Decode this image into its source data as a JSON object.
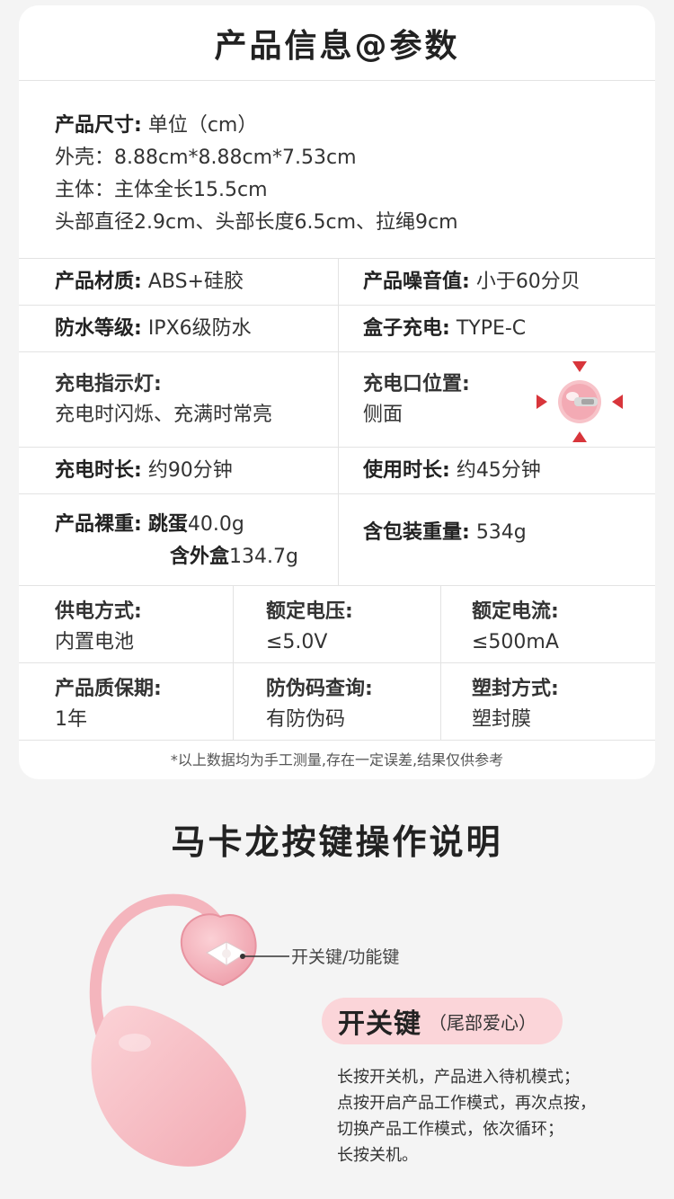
{
  "info": {
    "title": "产品信息@参数",
    "size": {
      "label": "产品尺寸:",
      "unit": "单位（cm）",
      "lines": [
        "外壳：8.88cm*8.88cm*7.53cm",
        "主体：主体全长15.5cm",
        "头部直径2.9cm、头部长度6.5cm、拉绳9cm"
      ]
    },
    "material": {
      "label": "产品材质:",
      "value": "ABS+硅胶"
    },
    "noise": {
      "label": "产品噪音值:",
      "value": "小于60分贝"
    },
    "waterproof": {
      "label": "防水等级:",
      "value": "IPX6级防水"
    },
    "box_charge": {
      "label": "盒子充电:",
      "value": "TYPE-C"
    },
    "indicator": {
      "label": "充电指示灯:",
      "value": "充电时闪烁、充满时常亮"
    },
    "port": {
      "label": "充电口位置:",
      "value": "侧面"
    },
    "charge_time": {
      "label": "充电时长:",
      "value": "约90分钟"
    },
    "use_time": {
      "label": "使用时长:",
      "value": "约45分钟"
    },
    "net_weight": {
      "label": "产品裸重:",
      "egg_label": "跳蛋",
      "egg_value": "40.0g",
      "box_label": "含外盒",
      "box_value": "134.7g"
    },
    "gross_weight": {
      "label": "含包装重量:",
      "value": "534g"
    },
    "power": {
      "label": "供电方式:",
      "value": "内置电池"
    },
    "voltage": {
      "label": "额定电压:",
      "value": "≤5.0V"
    },
    "current": {
      "label": "额定电流:",
      "value": "≤500mA"
    },
    "warranty": {
      "label": "产品质保期:",
      "value": "1年"
    },
    "anti_fake": {
      "label": "防伪码查询:",
      "value": "有防伪码"
    },
    "seal": {
      "label": "塑封方式:",
      "value": "塑封膜"
    },
    "note": "*以上数据均为手工测量,存在一定误差,结果仅供参考"
  },
  "guide": {
    "title": "马卡龙按键操作说明",
    "callout": "开关键/功能键",
    "key_name": "开关键",
    "key_sub": "（尾部爱心）",
    "lines": [
      "长按开关机，产品进入待机模式；",
      "点按开启产品工作模式，再次点按，",
      "切换产品工作模式，依次循环；",
      "长按关机。"
    ]
  },
  "colors": {
    "accent_pink": "#f4b5bd",
    "pill_bg": "#fbd5d9",
    "arrow_red": "#d8353b"
  },
  "icons": [
    "charging-port-icon",
    "arrow-icon",
    "bow-icon"
  ]
}
